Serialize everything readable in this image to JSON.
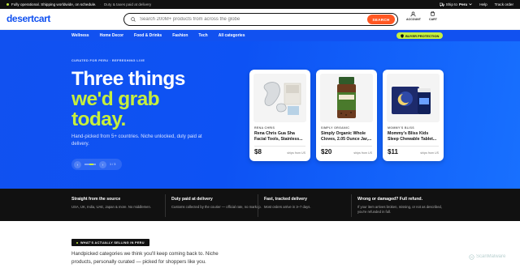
{
  "topbar": {
    "status": "Fully operational. Shipping worldwide, on schedule.",
    "duty": "Duty & taxes paid at delivery",
    "ship_to_label": "Ship to",
    "ship_to_country": "Peru",
    "help": "Help",
    "track_order": "Track order"
  },
  "header": {
    "logo": "desertcart",
    "search_placeholder": "Search 200M+ products from across the globe",
    "search_button": "SEARCH",
    "account": "ACCOUNT",
    "cart": "CART"
  },
  "nav": {
    "items": [
      "Wellness",
      "Home Decor",
      "Food & Drinks",
      "Fashion",
      "Tech",
      "All categories"
    ],
    "protection": "BUYER PROTECTION"
  },
  "hero": {
    "kicker": "CURATED FOR PERU · REFRESHING LIVE",
    "title_line1": "Three things",
    "title_line2": "we'd grab",
    "title_line3": "today.",
    "subtitle": "Hand-picked from 5+ countries. Niche unlocked, duty paid at delivery.",
    "prev": "‹",
    "next": "›",
    "page": "1 / 3"
  },
  "products": [
    {
      "brand": "RENA CHRIS",
      "name": "Rena Chris Gua Sha Facial Tools, Stainless...",
      "price": "$8",
      "from": "ships from US"
    },
    {
      "brand": "SIMPLY ORGANIC",
      "name": "Simply Organic Whole Cloves, 2.05 Ounce Jar,...",
      "price": "$20",
      "from": "ships from US"
    },
    {
      "brand": "MOMMY'S BLISS",
      "name": "Mommy's Bliss Kids Sleep Chewable Tablet...",
      "price": "$11",
      "from": "ships from US"
    }
  ],
  "features": [
    {
      "title": "Straight from the source",
      "desc": "USA, UK, India, UAE, Japan & more. No middlemen."
    },
    {
      "title": "Duty paid at delivery",
      "desc": "Customs collected by the courier — official rate, no markup."
    },
    {
      "title": "Fast, tracked delivery",
      "desc": "Most orders arrive in 3–7 days."
    },
    {
      "title": "Wrong or damaged? Full refund.",
      "desc": "If your item arrives broken, missing, or not as described, you're refunded in full."
    }
  ],
  "section": {
    "badge": "WHAT'S ACTUALLY SELLING IN PERU",
    "text": "Handpicked categories we think you'll keep coming back to. Niche products, personally curated — picked for shoppers like you."
  },
  "watermark": "ScanMalware",
  "colors": {
    "brand": "#1151f0",
    "accent": "#c6ef3d",
    "search_button": "#ff5722"
  }
}
